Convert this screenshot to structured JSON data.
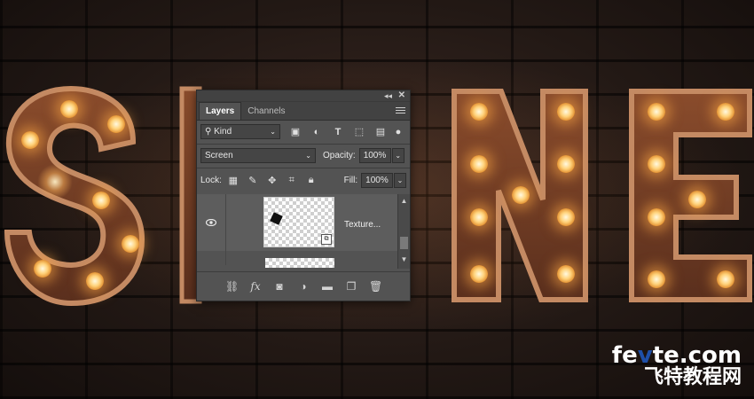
{
  "panel": {
    "tabs": [
      "Layers",
      "Channels"
    ],
    "kind_label": "Kind",
    "blend_mode": "Screen",
    "opacity_label": "Opacity:",
    "opacity_value": "100%",
    "lock_label": "Lock:",
    "fill_label": "Fill:",
    "fill_value": "100%",
    "layer_name": "Texture..."
  },
  "watermark": {
    "top_black": "fe",
    "top_blue": "v",
    "top_rest": "te.com",
    "bottom": "飞特教程网"
  },
  "colors": {
    "wall": "#1b1411",
    "letter_face": "#6e3d26",
    "letter_edge": "#b87a55",
    "bulb": "#ffd27a",
    "panel_bg": "#535353",
    "watermark_blue": "#1e4fa8"
  },
  "icons": [
    "search-icon",
    "pixel-filter-icon",
    "adjustment-filter-icon",
    "type-filter-icon",
    "shape-filter-icon",
    "smart-object-filter-icon",
    "filter-toggle-icon",
    "lock-transparent-icon",
    "lock-image-icon",
    "lock-position-icon",
    "lock-artboard-icon",
    "lock-all-icon",
    "eye-icon",
    "smart-object-badge-icon",
    "link-icon",
    "fx-icon",
    "mask-icon",
    "adjustment-icon",
    "folder-icon",
    "new-layer-icon",
    "trash-icon",
    "panel-menu-icon"
  ]
}
